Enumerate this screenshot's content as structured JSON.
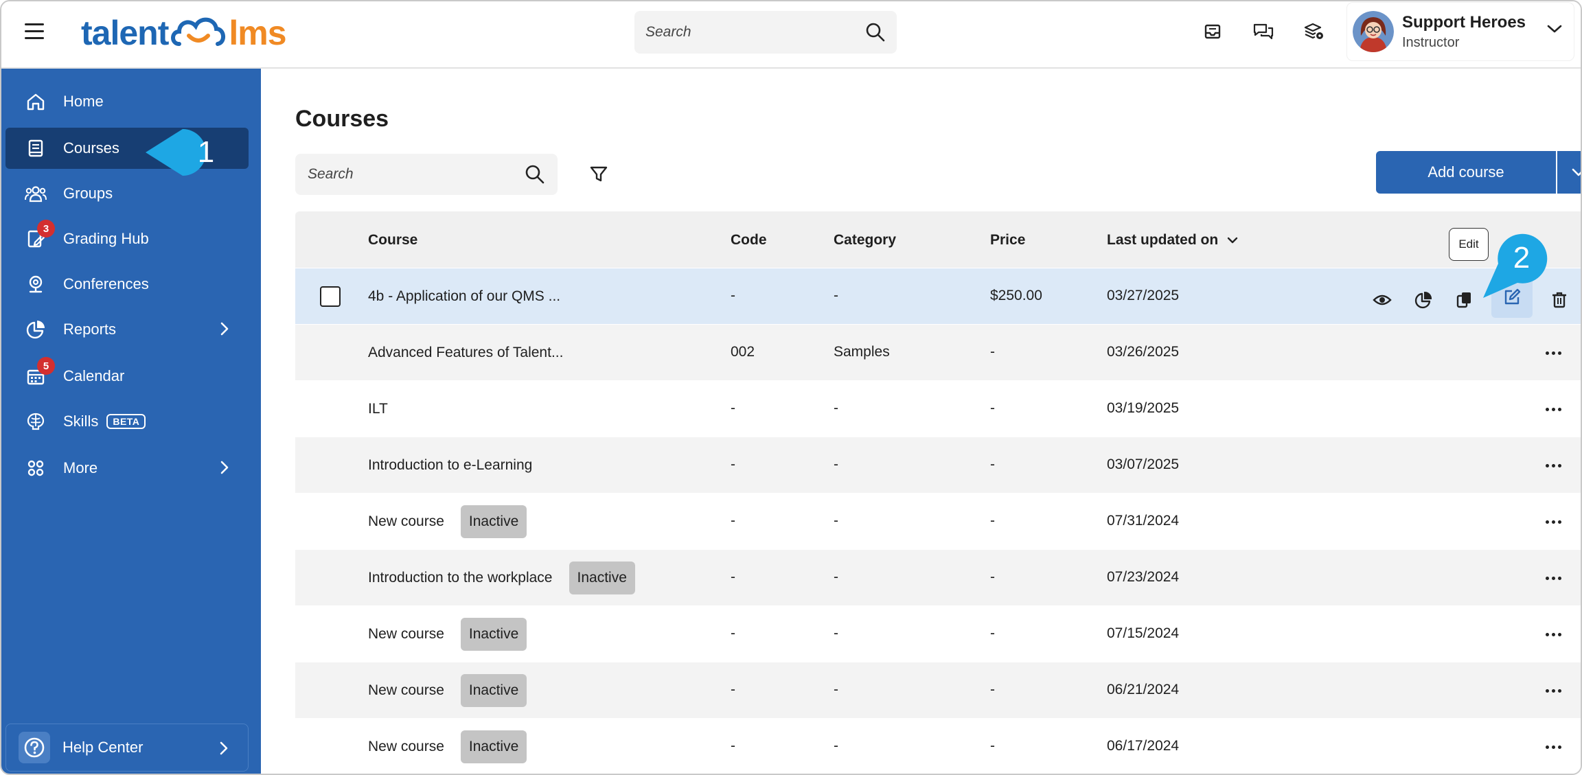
{
  "app": {
    "logo_left": "talent",
    "logo_right": "lms",
    "search_placeholder": "Search"
  },
  "user": {
    "name": "Support Heroes",
    "role": "Instructor"
  },
  "sidebar": {
    "items": [
      {
        "label": "Home",
        "icon": "home-icon"
      },
      {
        "label": "Courses",
        "icon": "book-icon",
        "active": true
      },
      {
        "label": "Groups",
        "icon": "groups-icon"
      },
      {
        "label": "Grading Hub",
        "icon": "grading-icon",
        "badge": "3"
      },
      {
        "label": "Conferences",
        "icon": "conference-icon"
      },
      {
        "label": "Reports",
        "icon": "pie-chart-icon",
        "chevron": true
      },
      {
        "label": "Calendar",
        "icon": "calendar-icon",
        "badge": "5"
      },
      {
        "label": "Skills",
        "icon": "skills-icon",
        "tag": "BETA"
      },
      {
        "label": "More",
        "icon": "grid-icon",
        "chevron": true
      }
    ],
    "help_center": "Help Center"
  },
  "callouts": {
    "first": "1",
    "second": "2"
  },
  "main": {
    "title": "Courses",
    "search_placeholder": "Search",
    "add_course_label": "Add course",
    "tooltip": "Edit"
  },
  "table": {
    "headers": {
      "course": "Course",
      "code": "Code",
      "category": "Category",
      "price": "Price",
      "updated": "Last updated on"
    },
    "rows": [
      {
        "course": "4b - Application of our QMS ...",
        "code": "-",
        "category": "-",
        "price": "$250.00",
        "updated": "03/27/2025",
        "tag": ""
      },
      {
        "course": "Advanced Features of Talent...",
        "code": "002",
        "category": "Samples",
        "price": "-",
        "updated": "03/26/2025",
        "tag": ""
      },
      {
        "course": "ILT",
        "code": "-",
        "category": "-",
        "price": "-",
        "updated": "03/19/2025",
        "tag": ""
      },
      {
        "course": "Introduction to e-Learning",
        "code": "-",
        "category": "-",
        "price": "-",
        "updated": "03/07/2025",
        "tag": ""
      },
      {
        "course": "New course",
        "code": "-",
        "category": "-",
        "price": "-",
        "updated": "07/31/2024",
        "tag": "Inactive"
      },
      {
        "course": "Introduction to the workplace",
        "code": "-",
        "category": "-",
        "price": "-",
        "updated": "07/23/2024",
        "tag": "Inactive"
      },
      {
        "course": "New course",
        "code": "-",
        "category": "-",
        "price": "-",
        "updated": "07/15/2024",
        "tag": "Inactive"
      },
      {
        "course": "New course",
        "code": "-",
        "category": "-",
        "price": "-",
        "updated": "06/21/2024",
        "tag": "Inactive"
      },
      {
        "course": "New course",
        "code": "-",
        "category": "-",
        "price": "-",
        "updated": "06/17/2024",
        "tag": "Inactive"
      }
    ]
  },
  "colors": {
    "sidebar": "#2a65b2",
    "sidebar_active": "#173e73",
    "brand_blue": "#1e67b4",
    "brand_orange": "#f08a24",
    "callout": "#1ea7e4",
    "selected_row": "#dce9f7"
  }
}
